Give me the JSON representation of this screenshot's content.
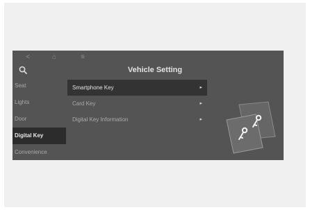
{
  "header": {
    "back_icon": "<",
    "home_icon": "⌂",
    "menu_icon": "≡",
    "title": "Vehicle Setting"
  },
  "sidebar": {
    "items": [
      {
        "label": "Seat"
      },
      {
        "label": "Lights"
      },
      {
        "label": "Door"
      },
      {
        "label": "Digital Key",
        "active": true
      },
      {
        "label": "Convenience"
      }
    ]
  },
  "menu": {
    "items": [
      {
        "label": "Smartphone Key",
        "active": true
      },
      {
        "label": "Card Key"
      },
      {
        "label": "Digital Key Information"
      }
    ],
    "arrow_glyph": "▸"
  },
  "colors": {
    "background": "#545454",
    "active": "#2c2c2c",
    "text": "#e2e2e2"
  }
}
